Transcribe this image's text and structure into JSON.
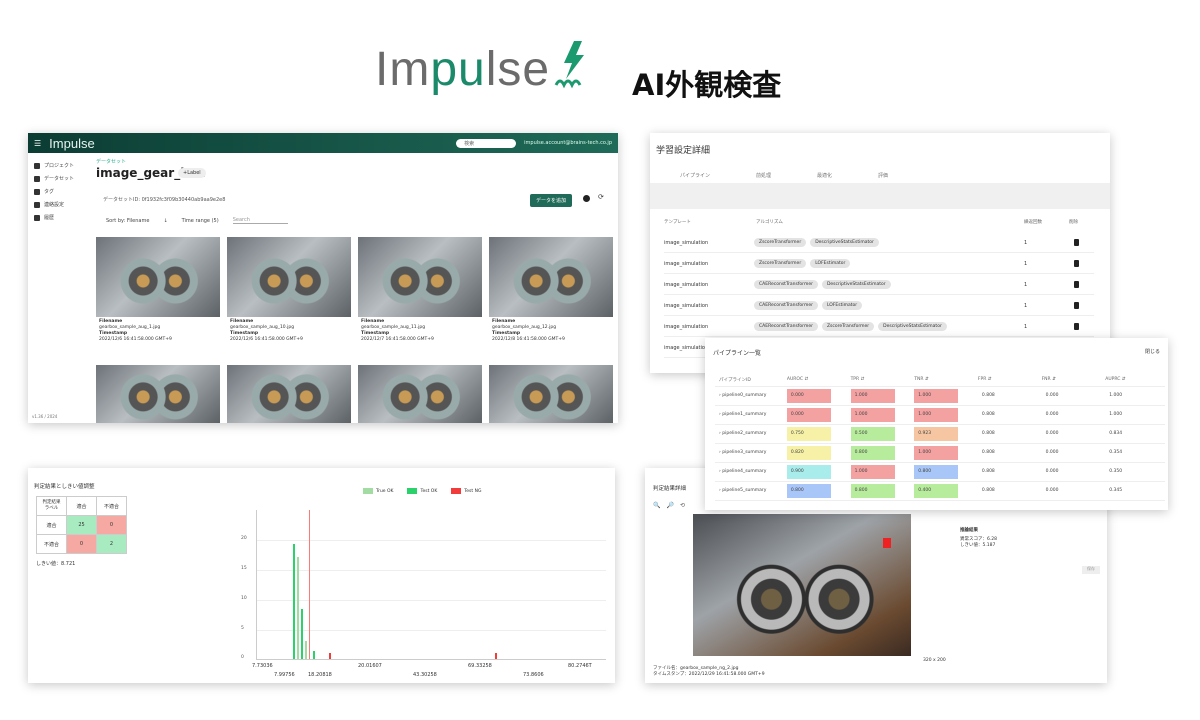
{
  "header": {
    "brand": "Impulse",
    "title": "AI外観検査"
  },
  "datasets": {
    "brand": "Impulse",
    "search_placeholder": "検索",
    "user": "impulse.account@brains-tech.co.jp",
    "sidebar": [
      {
        "label": "プロジェクト",
        "icon": "folder-icon"
      },
      {
        "label": "データセット",
        "icon": "dataset-icon"
      },
      {
        "label": "タグ",
        "icon": "tag-icon"
      },
      {
        "label": "連絡設定",
        "icon": "gear-icon"
      },
      {
        "label": "履歴",
        "icon": "chart-icon"
      }
    ],
    "sidebar_footer": "v1.36 / 2024",
    "breadcrumb": "データセット",
    "title": "image_gear_box",
    "tag": "+Label",
    "dataset_id": "データセットID: 0f1932fc3f09b30440ab9aa9e2e8",
    "add_button": "データを追加",
    "sort": "Sort by: Filename",
    "filter": "Time range (5)",
    "search": "Search",
    "cards": [
      {
        "fl": "Filename",
        "fn": "gearbox_sample_aug_1.jpg",
        "tl": "Timestamp",
        "ts": "2022/12/6 16:41:58.000 GMT+9"
      },
      {
        "fl": "Filename",
        "fn": "gearbox_sample_aug_10.jpg",
        "tl": "Timestamp",
        "ts": "2022/12/6 16:41:58.000 GMT+9"
      },
      {
        "fl": "Filename",
        "fn": "gearbox_sample_aug_11.jpg",
        "tl": "Timestamp",
        "ts": "2022/12/7 16:41:58.000 GMT+9"
      },
      {
        "fl": "Filename",
        "fn": "gearbox_sample_aug_12.jpg",
        "tl": "Timestamp",
        "ts": "2022/12/8 16:41:58.000 GMT+9"
      }
    ]
  },
  "learning": {
    "title": "学習設定詳細",
    "tabs": [
      "パイプライン",
      "前処理",
      "最適化",
      "評価"
    ],
    "headers": [
      "テンプレート",
      "アルゴリズム",
      "繰返回数",
      "削除"
    ],
    "rows": [
      {
        "template": "image_simulation",
        "chips": [
          "ZscoreTransformer",
          "DescriptiveStatsEstimator"
        ],
        "n": "1"
      },
      {
        "template": "image_simulation",
        "chips": [
          "ZscoreTransformer",
          "LOFEstimator"
        ],
        "n": "1"
      },
      {
        "template": "image_simulation",
        "chips": [
          "CAEReconstTransformer",
          "DescriptiveStatsEstimator"
        ],
        "n": "1"
      },
      {
        "template": "image_simulation",
        "chips": [
          "CAEReconstTransformer",
          "LOFEstimator"
        ],
        "n": "1"
      },
      {
        "template": "image_simulation",
        "chips": [
          "CAEReconstTransformer",
          "ZscoreTransformer",
          "DescriptiveStatsEstimator"
        ],
        "n": "1"
      },
      {
        "template": "image_simulation",
        "chips": [],
        "n": ""
      }
    ]
  },
  "pipelines": {
    "title": "パイプライン一覧",
    "close": "閉じる",
    "headers": [
      "パイプラインID",
      "AUROC ⇵",
      "TPR ⇵",
      "TNR ⇵",
      "FPR ⇵",
      "FNR ⇵",
      "AUPRC ⇵"
    ],
    "rows": [
      {
        "id": "pipeline0_summary",
        "v": [
          "0.000",
          "1.000",
          "1.000",
          "0.808",
          "0.000",
          "1.000"
        ],
        "c": [
          "red",
          "red",
          "red",
          "",
          "",
          ""
        ]
      },
      {
        "id": "pipeline1_summary",
        "v": [
          "0.000",
          "1.000",
          "1.000",
          "0.808",
          "0.000",
          "1.000"
        ],
        "c": [
          "red",
          "red",
          "red",
          "",
          "",
          ""
        ]
      },
      {
        "id": "pipeline2_summary",
        "v": [
          "0.750",
          "0.500",
          "0.923",
          "0.808",
          "0.000",
          "0.834"
        ],
        "c": [
          "yel",
          "grn",
          "ora",
          "",
          "",
          ""
        ]
      },
      {
        "id": "pipeline3_summary",
        "v": [
          "0.820",
          "0.800",
          "1.000",
          "0.808",
          "0.000",
          "0.354"
        ],
        "c": [
          "yel",
          "grn",
          "red",
          "",
          "",
          ""
        ]
      },
      {
        "id": "pipeline4_summary",
        "v": [
          "0.900",
          "1.000",
          "0.800",
          "0.808",
          "0.000",
          "0.350"
        ],
        "c": [
          "cya",
          "red",
          "blu",
          "",
          "",
          ""
        ]
      },
      {
        "id": "pipeline5_summary",
        "v": [
          "0.800",
          "0.800",
          "0.400",
          "0.808",
          "0.000",
          "0.345"
        ],
        "c": [
          "blu",
          "grn",
          "grn",
          "",
          "",
          ""
        ]
      }
    ]
  },
  "threshold": {
    "title": "判定結果としきい値調整",
    "matrix": {
      "corner_top": "判定結果",
      "corner_bottom": "ラベル",
      "col1": "適合",
      "col2": "不適合",
      "row1": "適合",
      "row2": "不適合",
      "v11": "25",
      "v12": "0",
      "v21": "0",
      "v22": "2"
    },
    "threshold_label": "しきい値：8.721",
    "legend": [
      "True OK",
      "Test OK",
      "Test NG"
    ],
    "yticks": [
      "20",
      "15",
      "10",
      "5",
      "0"
    ],
    "xticks_top": [
      "7.73036",
      "20.01607",
      "69.33258",
      "80.2746T"
    ],
    "xticks_bottom": [
      "7.99756",
      "18.20818",
      "43.30258",
      "73.8606"
    ]
  },
  "detail": {
    "title": "判定結果詳細",
    "tools": [
      "🔍",
      "🔎",
      "⟲"
    ],
    "result_title": "推論結果",
    "score": "異常スコア：6.28",
    "thr": "しきい値：5.187",
    "button": "保存",
    "file": "ファイル名：gearbox_sample_ng_2.jpg",
    "time": "タイムスタンプ：2022/12/29 16:41:58.000 GMT+9",
    "size": "320 x 200"
  }
}
